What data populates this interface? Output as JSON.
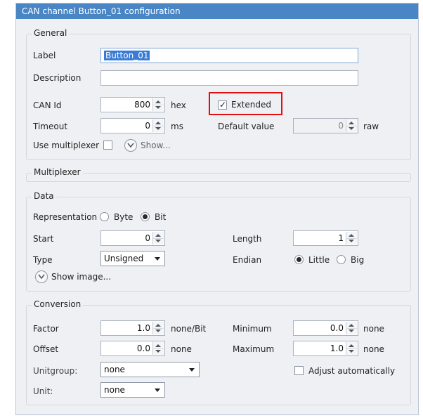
{
  "window": {
    "title": "CAN channel Button_01 configuration"
  },
  "general": {
    "title": "General",
    "label_label": "Label",
    "label_value": "Button_01",
    "description_label": "Description",
    "description_value": "",
    "canid_label": "CAN Id",
    "canid_value": "800",
    "canid_unit": "hex",
    "extended_label": "Extended",
    "extended_checked": true,
    "timeout_label": "Timeout",
    "timeout_value": "0",
    "timeout_unit": "ms",
    "default_label": "Default value",
    "default_value": "0",
    "default_unit": "raw",
    "multiplexer_label": "Use multiplexer",
    "multiplexer_checked": false,
    "show_label": "Show..."
  },
  "multiplexer": {
    "title": "Multiplexer"
  },
  "data": {
    "title": "Data",
    "representation_label": "Representation",
    "rep_byte": "Byte",
    "rep_bit": "Bit",
    "rep_selected": "Bit",
    "start_label": "Start",
    "start_value": "0",
    "length_label": "Length",
    "length_value": "1",
    "type_label": "Type",
    "type_value": "Unsigned",
    "endian_label": "Endian",
    "endian_little": "Little",
    "endian_big": "Big",
    "endian_selected": "Little",
    "show_image_label": "Show image..."
  },
  "conversion": {
    "title": "Conversion",
    "factor_label": "Factor",
    "factor_value": "1.0",
    "factor_unit": "none/Bit",
    "minimum_label": "Minimum",
    "minimum_value": "0.0",
    "minimum_unit": "none",
    "offset_label": "Offset",
    "offset_value": "0.0",
    "offset_unit": "none",
    "maximum_label": "Maximum",
    "maximum_value": "1.0",
    "maximum_unit": "none",
    "unitgroup_label": "Unitgroup:",
    "unitgroup_value": "none",
    "adjust_label": "Adjust automatically",
    "adjust_checked": false,
    "unit_label": "Unit:",
    "unit_value": "none"
  },
  "colors": {
    "titlebar": "#4a86c5",
    "background": "#eef0f3",
    "highlight": "#e01010",
    "selection": "#3a7bd5"
  }
}
